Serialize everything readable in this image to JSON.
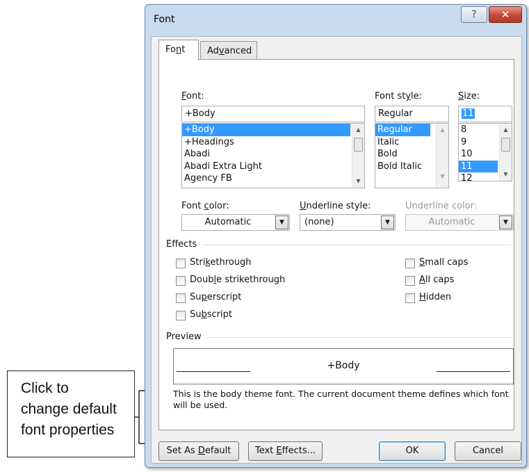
{
  "dialog": {
    "title": "Font",
    "help_label": "?",
    "close_label": "✕"
  },
  "tabs": [
    {
      "label_pre": "Fo",
      "label_u": "n",
      "label_post": "t",
      "active": true
    },
    {
      "label_pre": "Ad",
      "label_u": "v",
      "label_post": "anced",
      "active": false
    }
  ],
  "font": {
    "label_u": "F",
    "label_post": "ont:",
    "value": "+Body",
    "list": [
      "+Body",
      "+Headings",
      "Abadi",
      "Abadi Extra Light",
      "Agency FB"
    ],
    "selected": "+Body"
  },
  "font_style": {
    "label_pre": "Font st",
    "label_u": "y",
    "label_post": "le:",
    "value": "Regular",
    "list": [
      "Regular",
      "Italic",
      "Bold",
      "Bold Italic"
    ],
    "selected": "Regular"
  },
  "size": {
    "label_u": "S",
    "label_post": "ize:",
    "value": "11",
    "list": [
      "8",
      "9",
      "10",
      "11",
      "12"
    ],
    "selected": "11"
  },
  "font_color": {
    "label_pre": "Font ",
    "label_u": "c",
    "label_post": "olor:",
    "value": "Automatic"
  },
  "underline_style": {
    "label_u": "U",
    "label_post": "nderline style:",
    "value": "(none)"
  },
  "underline_color": {
    "label": "Underline color:",
    "value": "Automatic"
  },
  "effects": {
    "heading": "Effects",
    "items": [
      {
        "pre": "Stri",
        "u": "k",
        "post": "ethrough"
      },
      {
        "pre": "Doub",
        "u": "l",
        "post": "e strikethrough"
      },
      {
        "pre": "Su",
        "u": "p",
        "post": "erscript"
      },
      {
        "pre": "Su",
        "u": "b",
        "post": "script"
      },
      {
        "pre": "",
        "u": "S",
        "post": "mall caps"
      },
      {
        "pre": "",
        "u": "A",
        "post": "ll caps"
      },
      {
        "pre": "",
        "u": "H",
        "post": "idden"
      }
    ]
  },
  "preview": {
    "heading": "Preview",
    "sample": "+Body",
    "description": "This is the body theme font. The current document theme defines which font will be used."
  },
  "buttons": {
    "set_default_pre": "Set As ",
    "set_default_u": "D",
    "set_default_post": "efault",
    "text_effects_pre": "Text ",
    "text_effects_u": "E",
    "text_effects_post": "ffects...",
    "ok": "OK",
    "cancel": "Cancel"
  },
  "callout": {
    "lines": [
      "Click to",
      "change default",
      "font properties"
    ]
  },
  "icons": {
    "scroll_up": "chevron-up-icon",
    "scroll_down": "chevron-down-icon",
    "dropdown": "chevron-down-icon"
  },
  "colors": {
    "selection": "#3399ff",
    "close_button": "#c24a37",
    "title_bar": "#c9dbee"
  }
}
